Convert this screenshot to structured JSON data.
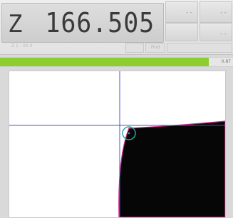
{
  "readout": {
    "axis": "Z",
    "value": "166.505"
  },
  "status": {
    "left_text": "Z 1 - 00 0",
    "box1": "",
    "box2": "Find",
    "box3": ""
  },
  "progress": {
    "fraction": 0.895,
    "label": "0.87"
  },
  "side_buttons": [
    "--",
    "--",
    "--"
  ],
  "colors": {
    "accent_green": "#8ccd30",
    "crosshair_blue": "#4656cf",
    "edge_magenta": "#cc2a86",
    "target_teal": "#2aa7a0"
  }
}
